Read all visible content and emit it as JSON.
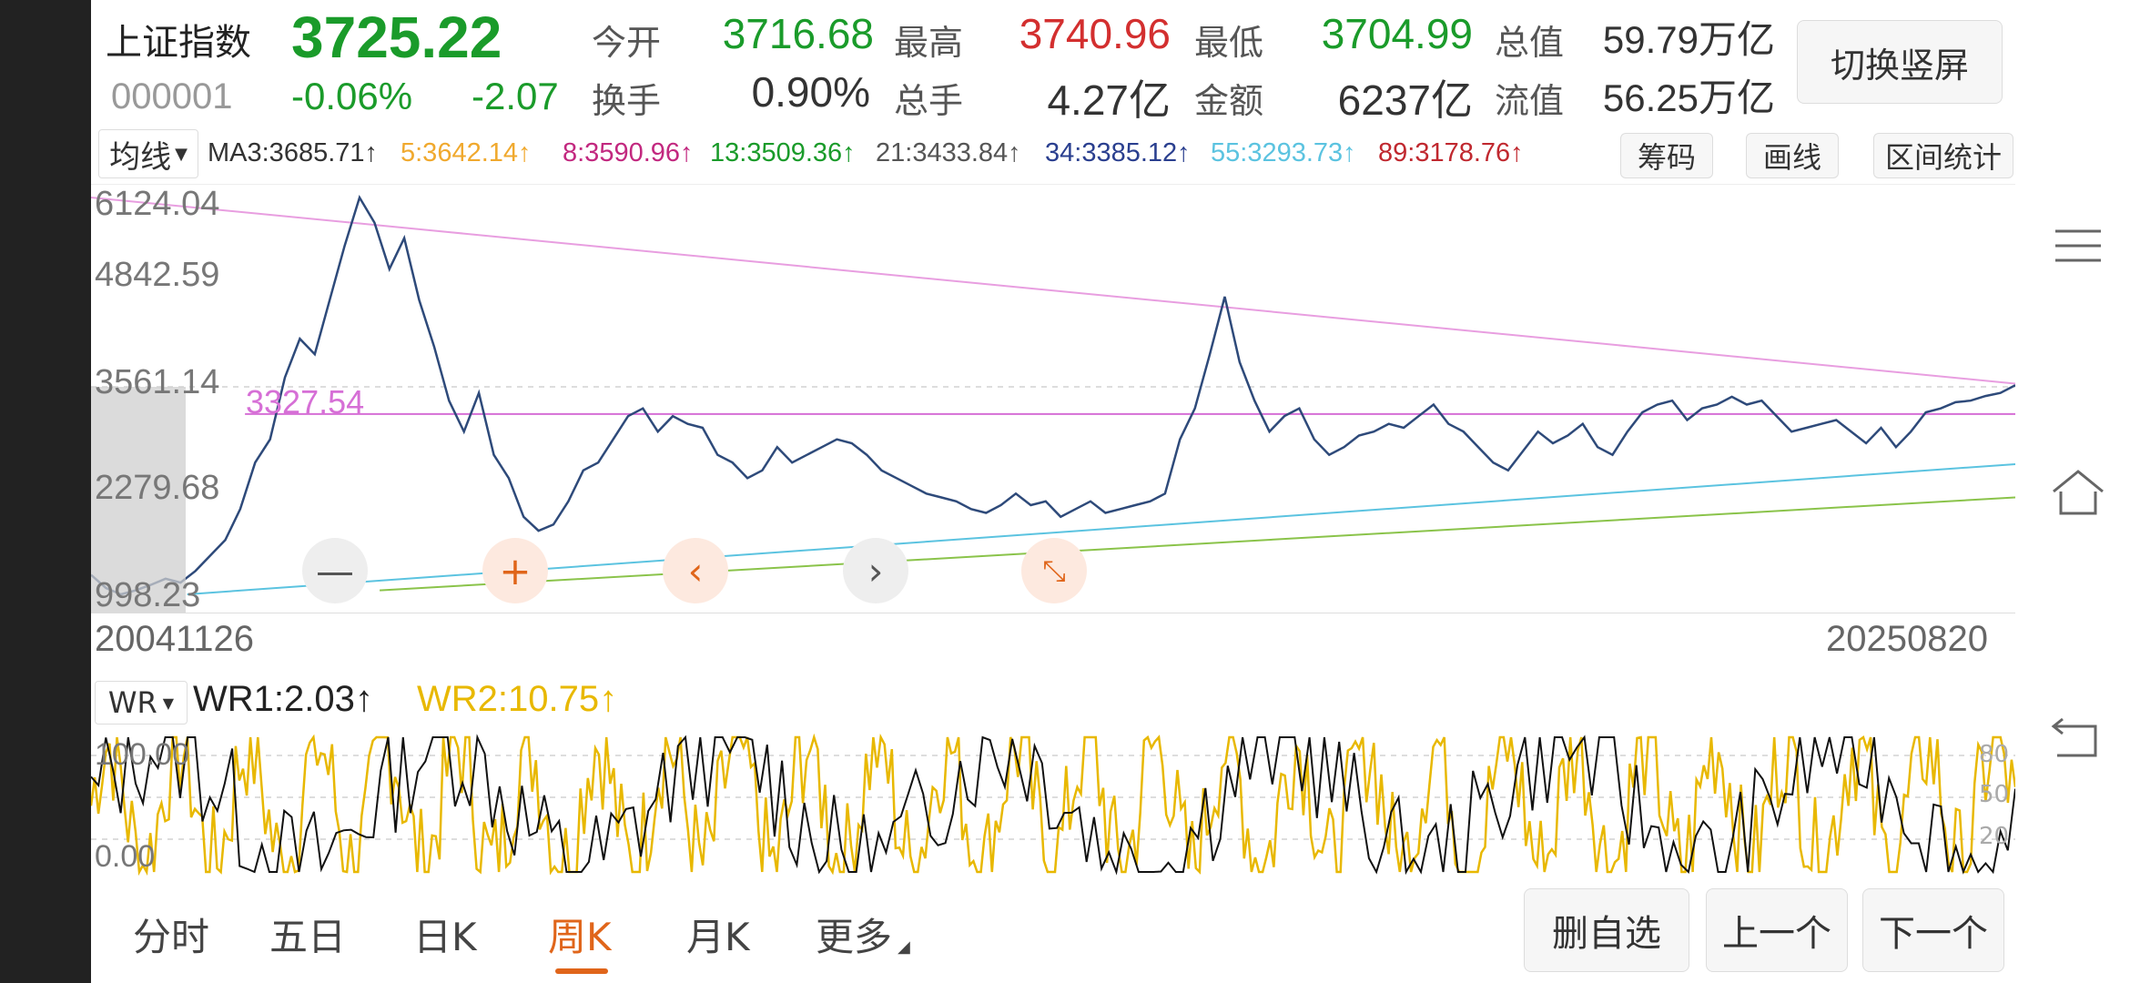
{
  "header": {
    "name": "上证指数",
    "price": "3725.22",
    "code": "000001",
    "pct_change": "-0.06%",
    "change": "-2.07",
    "stats": [
      {
        "label": "今开",
        "value": "3716.68",
        "color": "green"
      },
      {
        "label": "最高",
        "value": "3740.96",
        "color": "red"
      },
      {
        "label": "最低",
        "value": "3704.99",
        "color": "green"
      },
      {
        "label": "总值",
        "value": "59.79万亿",
        "color": "dark"
      },
      {
        "label": "换手",
        "value": "0.90%",
        "color": "dark"
      },
      {
        "label": "总手",
        "value": "4.27亿",
        "color": "dark"
      },
      {
        "label": "金额",
        "value": "6237亿",
        "color": "dark"
      },
      {
        "label": "流值",
        "value": "56.25万亿",
        "color": "dark"
      }
    ],
    "portrait_button": "切换竖屏"
  },
  "ma_bar": {
    "selector": "均线",
    "items": [
      {
        "text": "MA3:3685.71↑",
        "color": "#333333"
      },
      {
        "text": "5:3642.14↑",
        "color": "#f0a92e"
      },
      {
        "text": "8:3590.96↑",
        "color": "#c2287f"
      },
      {
        "text": "13:3509.36↑",
        "color": "#1a9b2a"
      },
      {
        "text": "21:3433.84↑",
        "color": "#555555"
      },
      {
        "text": "34:3385.12↑",
        "color": "#2a3f8f"
      },
      {
        "text": "55:3293.73↑",
        "color": "#5bc3e0"
      },
      {
        "text": "89:3178.76↑",
        "color": "#c0282f"
      }
    ],
    "tools": [
      "筹码",
      "画线",
      "区间统计"
    ]
  },
  "chart_data": {
    "type": "line",
    "title": "",
    "x_start": "20041126",
    "x_end": "20250820",
    "y_ticks": [
      "6124.04",
      "4842.59",
      "3561.14",
      "2279.68",
      "998.23"
    ],
    "ylim": [
      998.23,
      6124.04
    ],
    "hline_label": "3327.54",
    "hline_value": 3327.54,
    "series": [
      {
        "values": [
          1250,
          1080,
          998,
          1050,
          1120,
          1200,
          1150,
          1300,
          1500,
          1700,
          2100,
          2700,
          3000,
          3800,
          4300,
          4100,
          4800,
          5500,
          6124,
          5800,
          5200,
          5600,
          4800,
          4200,
          3500,
          3100,
          3600,
          2800,
          2500,
          2000,
          1820,
          1900,
          2200,
          2600,
          2700,
          3000,
          3300,
          3400,
          3100,
          3300,
          3200,
          3150,
          2800,
          2700,
          2500,
          2600,
          2900,
          2700,
          2800,
          2900,
          3000,
          2950,
          2800,
          2600,
          2500,
          2400,
          2300,
          2250,
          2200,
          2100,
          2050,
          2150,
          2300,
          2150,
          2200,
          2000,
          2100,
          2200,
          2050,
          2100,
          2150,
          2200,
          2300,
          3000,
          3400,
          4100,
          4842,
          4000,
          3500,
          3100,
          3300,
          3400,
          3000,
          2800,
          2900,
          3050,
          3100,
          3200,
          3150,
          3300,
          3450,
          3200,
          3100,
          2900,
          2700,
          2600,
          2850,
          3100,
          2950,
          3050,
          3200,
          2900,
          2800,
          3100,
          3350,
          3450,
          3500,
          3250,
          3400,
          3450,
          3550,
          3450,
          3500,
          3300,
          3100,
          3150,
          3200,
          3250,
          3100,
          2950,
          3150,
          2900,
          3100,
          3350,
          3400,
          3480,
          3500,
          3560,
          3600,
          3700
        ]
      }
    ],
    "annotation_lines": [
      {
        "color": "#e89ee0",
        "from": [
          0.0,
          6124.04
        ],
        "to": [
          1.0,
          3720
        ]
      },
      {
        "color": "#d66fd6",
        "from": [
          0.08,
          3327.54
        ],
        "to": [
          1.0,
          3327.54
        ]
      },
      {
        "color": "#5bc3e0",
        "from": [
          0.05,
          998.23
        ],
        "to": [
          1.0,
          2680
        ]
      },
      {
        "color": "#8ac34a",
        "from": [
          0.15,
          1050
        ],
        "to": [
          1.0,
          2250
        ]
      }
    ],
    "wr_series": [
      {
        "name": "WR1",
        "color": "#111111"
      },
      {
        "name": "WR2",
        "color": "#e8b800"
      }
    ],
    "wr_right_ticks": [
      "80",
      "50",
      "20"
    ]
  },
  "chart_left_labels": {
    "top": "100.00",
    "bottom": "0.00"
  },
  "wr_bar": {
    "selector": "WR",
    "wr1": "WR1:2.03↑",
    "wr2": "WR2:10.75↑"
  },
  "controls": [
    "zoom-out",
    "zoom-in",
    "scroll-left",
    "scroll-right",
    "collapse"
  ],
  "tabs": [
    {
      "label": "分时",
      "active": false
    },
    {
      "label": "五日",
      "active": false
    },
    {
      "label": "日K",
      "active": false
    },
    {
      "label": "周K",
      "active": true
    },
    {
      "label": "月K",
      "active": false
    },
    {
      "label": "更多",
      "active": false
    }
  ],
  "bottom_buttons": [
    "删自选",
    "上一个",
    "下一个"
  ]
}
